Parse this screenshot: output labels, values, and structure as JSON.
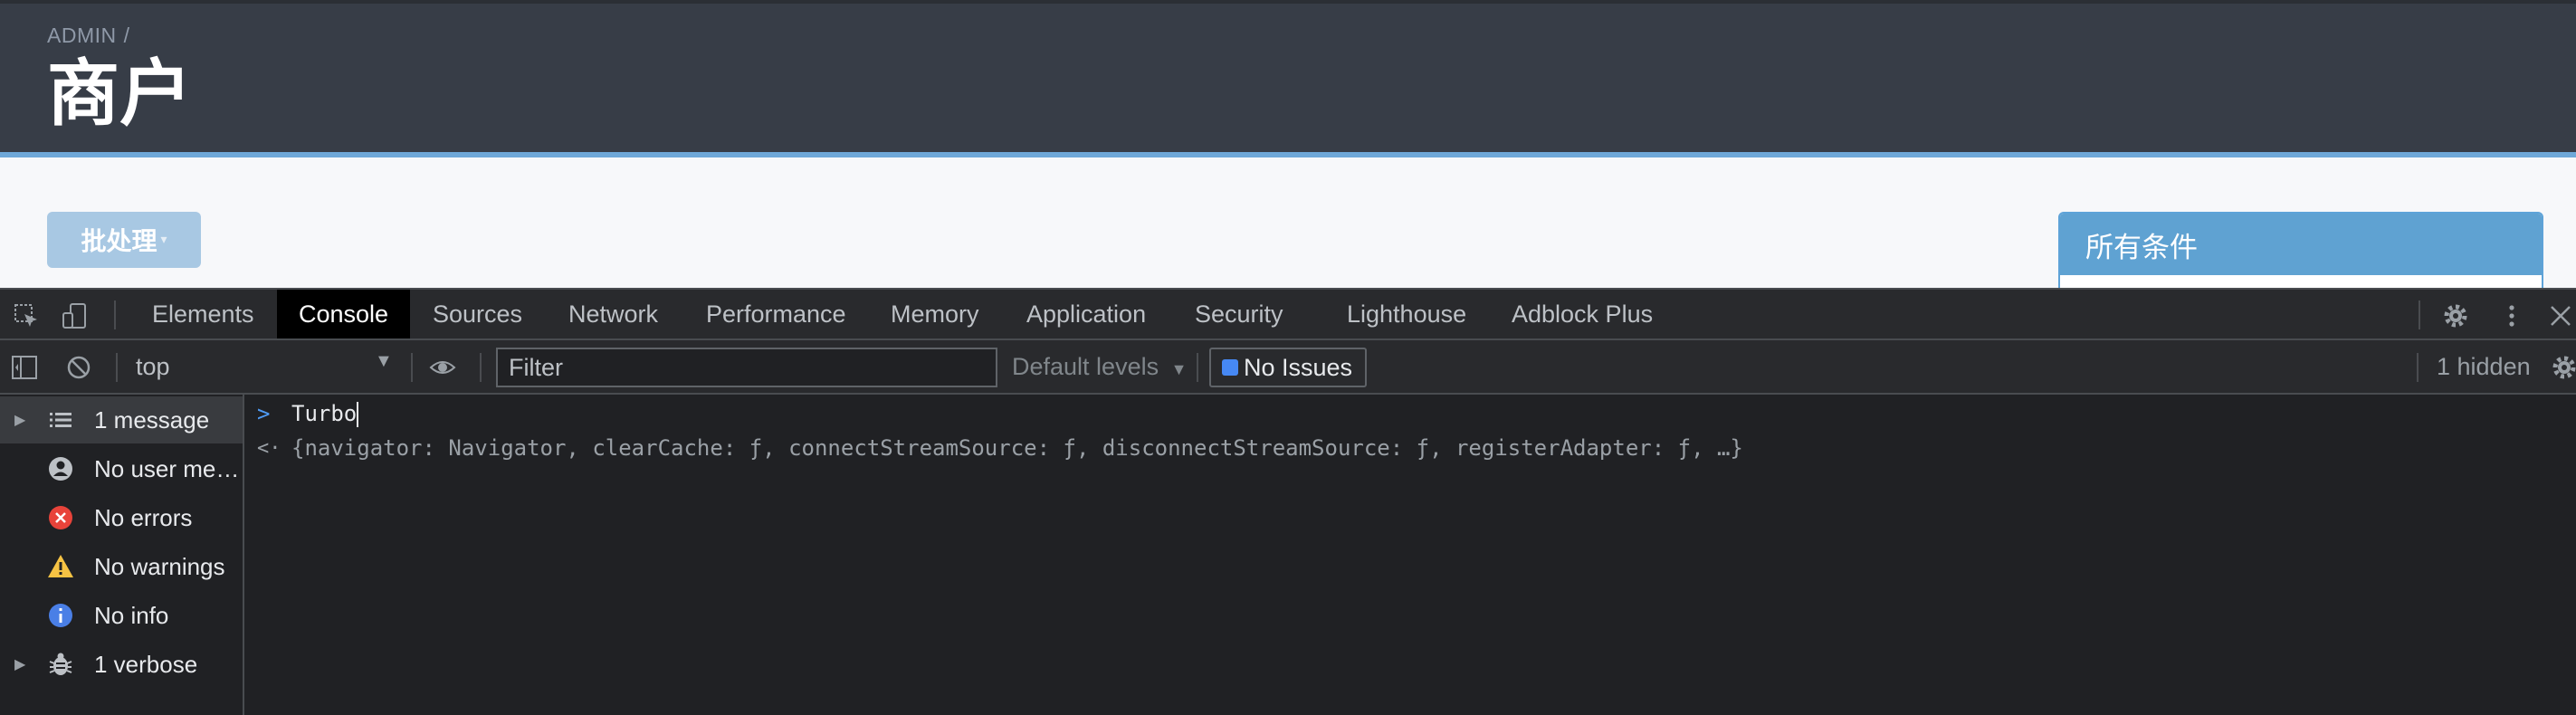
{
  "page": {
    "breadcrumb": "ADMIN",
    "breadcrumb_sep": "/",
    "title": "商户",
    "batch_button": "批处理",
    "filter_panel_title": "所有条件"
  },
  "devtools": {
    "tabs": [
      "Elements",
      "Console",
      "Sources",
      "Network",
      "Performance",
      "Memory",
      "Application",
      "Security",
      "Lighthouse",
      "Adblock Plus"
    ],
    "active_tab": "Console",
    "context": "top",
    "filter_placeholder": "Filter",
    "levels": "Default levels",
    "issues": "No Issues",
    "hidden": "1 hidden",
    "sidebar": [
      {
        "label": "1 message",
        "icon": "list-icon"
      },
      {
        "label": "No user me…",
        "icon": "user-icon"
      },
      {
        "label": "No errors",
        "icon": "error-icon"
      },
      {
        "label": "No warnings",
        "icon": "warning-icon"
      },
      {
        "label": "No info",
        "icon": "info-icon"
      },
      {
        "label": "1 verbose",
        "icon": "bug-icon"
      }
    ],
    "console": {
      "input": "Turbo",
      "result": "{navigator: Navigator, clearCache: ƒ, connectStreamSource: ƒ, disconnectStreamSource: ƒ, registerAdapter: ƒ, …}"
    }
  },
  "colors": {
    "header_bg": "#373d47",
    "accent": "#5fa2d2",
    "devtools_bg": "#202124"
  }
}
